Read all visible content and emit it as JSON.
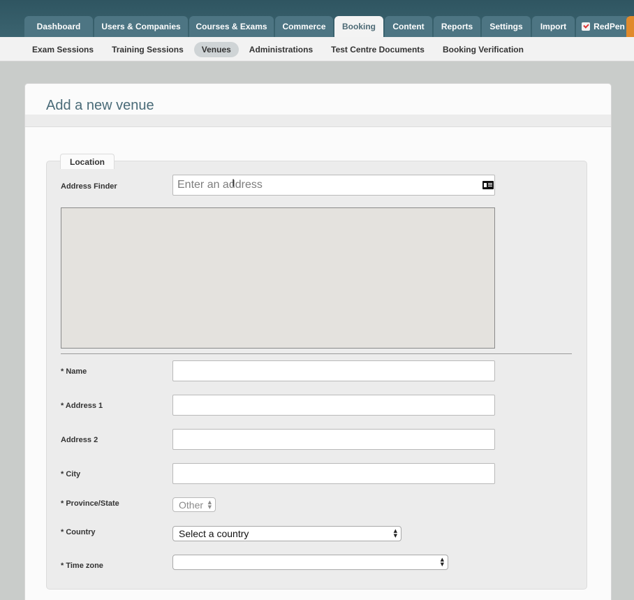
{
  "top_nav": {
    "tabs": [
      {
        "label": "Dashboard"
      },
      {
        "label": "Users & Companies"
      },
      {
        "label": "Courses & Exams"
      },
      {
        "label": "Commerce"
      },
      {
        "label": "Booking"
      },
      {
        "label": "Content"
      },
      {
        "label": "Reports"
      },
      {
        "label": "Settings"
      },
      {
        "label": "Import"
      },
      {
        "label": "RedPen"
      }
    ],
    "active": "Booking"
  },
  "sub_nav": {
    "items": [
      {
        "label": "Exam Sessions"
      },
      {
        "label": "Training Sessions"
      },
      {
        "label": "Venues"
      },
      {
        "label": "Administrations"
      },
      {
        "label": "Test Centre Documents"
      },
      {
        "label": "Booking Verification"
      }
    ],
    "active": "Venues"
  },
  "page": {
    "title": "Add a new venue"
  },
  "form": {
    "legend": "Location",
    "address_finder": {
      "label": "Address Finder",
      "placeholder": "Enter an address",
      "value": ""
    },
    "name": {
      "label": "* Name",
      "value": ""
    },
    "address1": {
      "label": "* Address 1",
      "value": ""
    },
    "address2": {
      "label": "Address 2",
      "value": ""
    },
    "city": {
      "label": "* City",
      "value": ""
    },
    "province": {
      "label": "* Province/State",
      "selected": "Other"
    },
    "country": {
      "label": "* Country",
      "selected": "Select a country"
    },
    "timezone": {
      "label": "* Time zone",
      "selected": ""
    }
  },
  "icons": {
    "contact_card": "contact-card-icon",
    "text_cursor": "text-cursor-icon",
    "redpen": "redpen-checkmark-icon",
    "select_arrows": "up-down-arrows-icon"
  },
  "colors": {
    "topbar": "#2f5561",
    "tab": "#4d7583",
    "active_tab": "#f3f3f3",
    "title": "#4a6b78",
    "accent_orange": "#e08a2c"
  }
}
